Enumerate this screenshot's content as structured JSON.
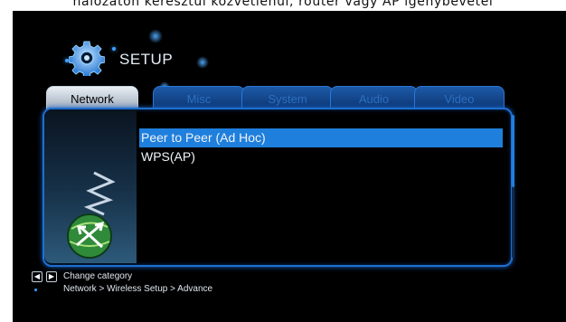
{
  "caption": "hálózaton keresztül közvetlenül, router vagy AP igénybevétel",
  "header": {
    "title": "SETUP",
    "icon": "gear-icon"
  },
  "tabs": [
    {
      "label": "Network",
      "active": true
    },
    {
      "label": "Misc",
      "active": false
    },
    {
      "label": "System",
      "active": false
    },
    {
      "label": "Audio",
      "active": false
    },
    {
      "label": "Video",
      "active": false
    }
  ],
  "menu": {
    "items": [
      {
        "label": "Peer to Peer (Ad Hoc)",
        "selected": true
      },
      {
        "label": "WPS(AP)",
        "selected": false
      }
    ]
  },
  "footer": {
    "hint": "Change category",
    "breadcrumb": "Network > Wireless Setup > Advance"
  },
  "colors": {
    "accent": "#1f7fdc",
    "border": "#1e6fd0",
    "background": "#000000"
  }
}
